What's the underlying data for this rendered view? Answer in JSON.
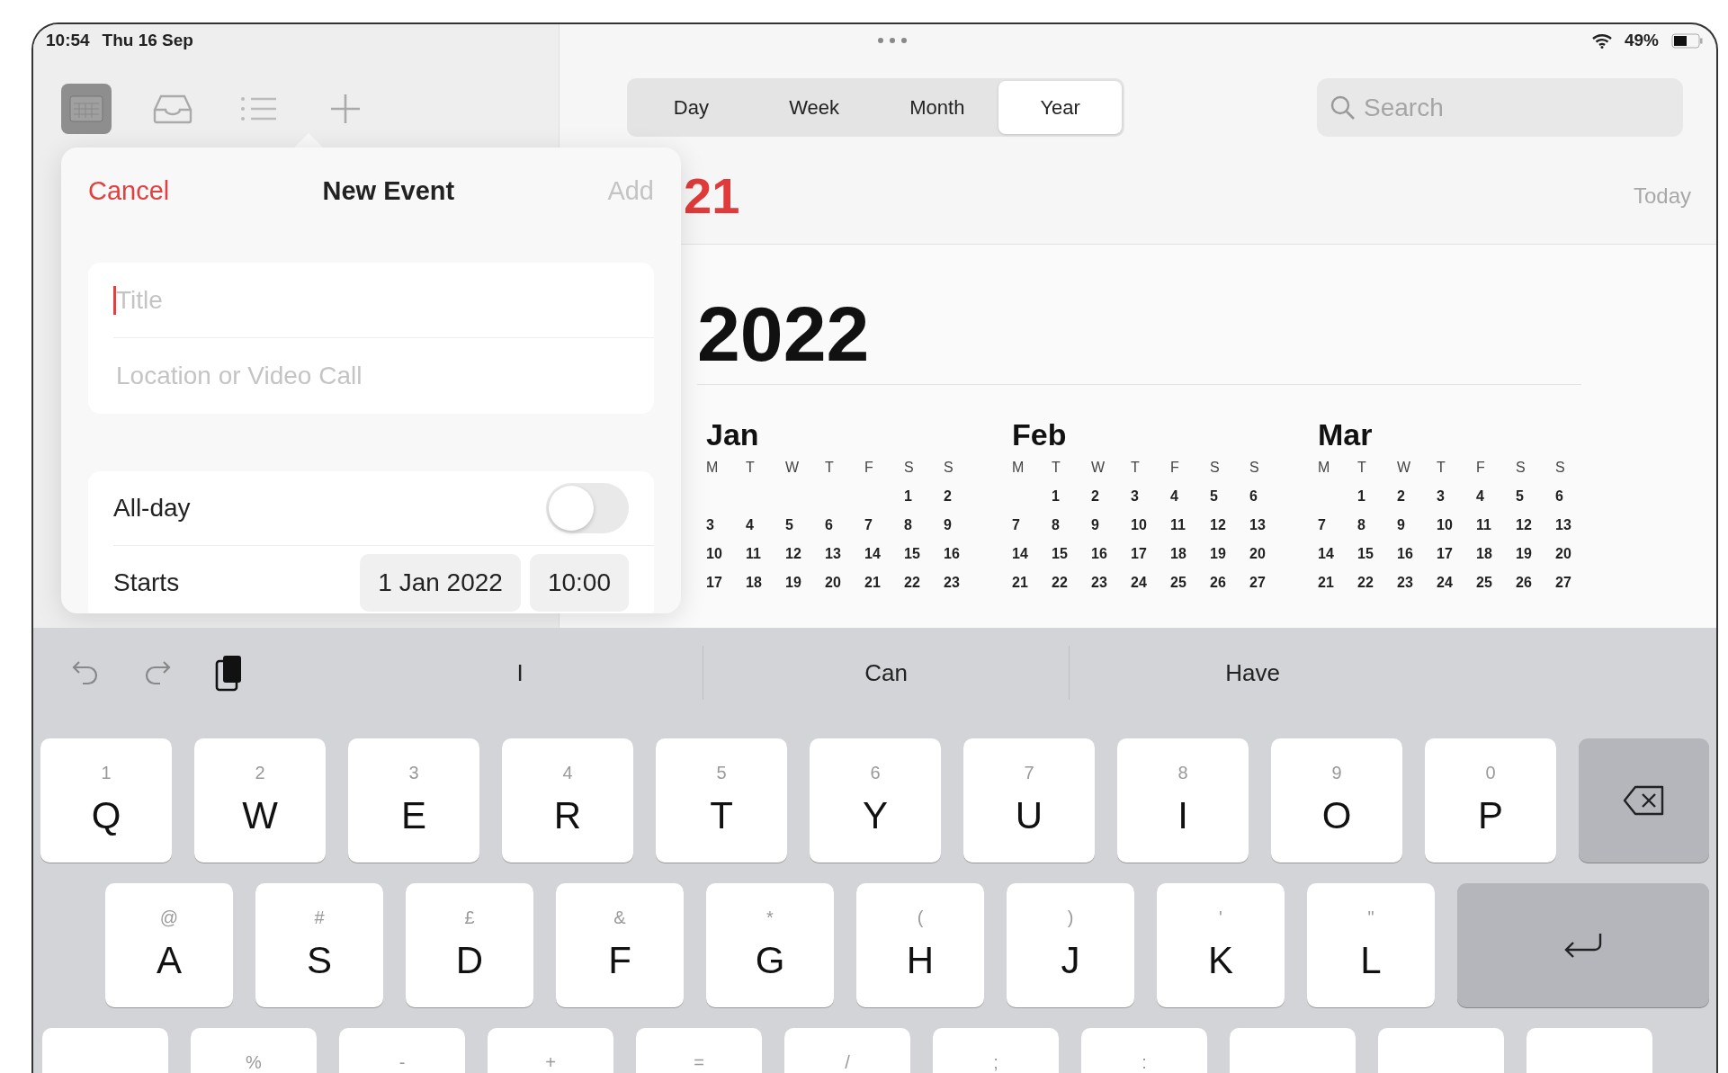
{
  "status_bar": {
    "time": "10:54",
    "date": "Thu 16 Sep",
    "battery": "49%"
  },
  "view_tabs": [
    {
      "label": "Day",
      "selected": false
    },
    {
      "label": "Week",
      "selected": false
    },
    {
      "label": "Month",
      "selected": false
    },
    {
      "label": "Year",
      "selected": true
    }
  ],
  "search": {
    "placeholder": "Search"
  },
  "today_button": "Today",
  "header_year": "21",
  "year_title": "2022",
  "months": [
    {
      "name": "Jan",
      "weekdays": [
        "M",
        "T",
        "W",
        "T",
        "F",
        "S",
        "S"
      ],
      "weeks": [
        [
          "1",
          "2"
        ],
        [
          "3",
          "4",
          "5",
          "6",
          "7",
          "8",
          "9"
        ],
        [
          "10",
          "11",
          "12",
          "13",
          "14",
          "15",
          "16"
        ],
        [
          "17",
          "18",
          "19",
          "20",
          "21",
          "22",
          "23"
        ]
      ]
    },
    {
      "name": "Feb",
      "weekdays": [
        "M",
        "T",
        "W",
        "T",
        "F",
        "S",
        "S"
      ],
      "weeks": [
        [
          "1",
          "2",
          "3",
          "4",
          "5",
          "6"
        ],
        [
          "7",
          "8",
          "9",
          "10",
          "11",
          "12",
          "13"
        ],
        [
          "14",
          "15",
          "16",
          "17",
          "18",
          "19",
          "20"
        ],
        [
          "21",
          "22",
          "23",
          "24",
          "25",
          "26",
          "27"
        ]
      ]
    },
    {
      "name": "Mar",
      "weekdays": [
        "M",
        "T",
        "W",
        "T",
        "F",
        "S",
        "S"
      ],
      "weeks": [
        [
          "1",
          "2",
          "3",
          "4",
          "5",
          "6"
        ],
        [
          "7",
          "8",
          "9",
          "10",
          "11",
          "12",
          "13"
        ],
        [
          "14",
          "15",
          "16",
          "17",
          "18",
          "19",
          "20"
        ],
        [
          "21",
          "22",
          "23",
          "24",
          "25",
          "26",
          "27"
        ]
      ]
    }
  ],
  "new_event": {
    "cancel": "Cancel",
    "title": "New Event",
    "add": "Add",
    "add_disabled": true,
    "fields": [
      {
        "placeholder": "Title",
        "focused": true
      },
      {
        "placeholder": "Location or Video Call",
        "focused": false
      }
    ],
    "all_day": {
      "label": "All-day",
      "checked": false
    },
    "starts": {
      "label": "Starts",
      "date": "1 Jan 2022",
      "time": "10:00"
    }
  },
  "suggestions": [
    "I",
    "Can",
    "Have"
  ],
  "keyboard": {
    "row_1": [
      {
        "hint": "1",
        "key": "Q"
      },
      {
        "hint": "2",
        "key": "W"
      },
      {
        "hint": "3",
        "key": "E"
      },
      {
        "hint": "4",
        "key": "R"
      },
      {
        "hint": "5",
        "key": "T"
      },
      {
        "hint": "6",
        "key": "Y"
      },
      {
        "hint": "7",
        "key": "U"
      },
      {
        "hint": "8",
        "key": "I"
      },
      {
        "hint": "9",
        "key": "O"
      },
      {
        "hint": "0",
        "key": "P"
      }
    ],
    "row_2": [
      {
        "hint": "@",
        "key": "A"
      },
      {
        "hint": "#",
        "key": "S"
      },
      {
        "hint": "£",
        "key": "D"
      },
      {
        "hint": "&",
        "key": "F"
      },
      {
        "hint": "*",
        "key": "G"
      },
      {
        "hint": "(",
        "key": "H"
      },
      {
        "hint": ")",
        "key": "J"
      },
      {
        "hint": "'",
        "key": "K"
      },
      {
        "hint": "\"",
        "key": "L"
      }
    ],
    "row_3": [
      {
        "kind": "shift"
      },
      {
        "kind": "char",
        "hint": "%"
      },
      {
        "kind": "char",
        "hint": "-"
      },
      {
        "kind": "char",
        "hint": "+"
      },
      {
        "kind": "char",
        "hint": "="
      },
      {
        "kind": "char",
        "hint": "/"
      },
      {
        "kind": "char",
        "hint": ";"
      },
      {
        "kind": "char",
        "hint": ":"
      },
      {
        "kind": "char"
      },
      {
        "kind": "char"
      },
      {
        "kind": "shift"
      }
    ]
  }
}
